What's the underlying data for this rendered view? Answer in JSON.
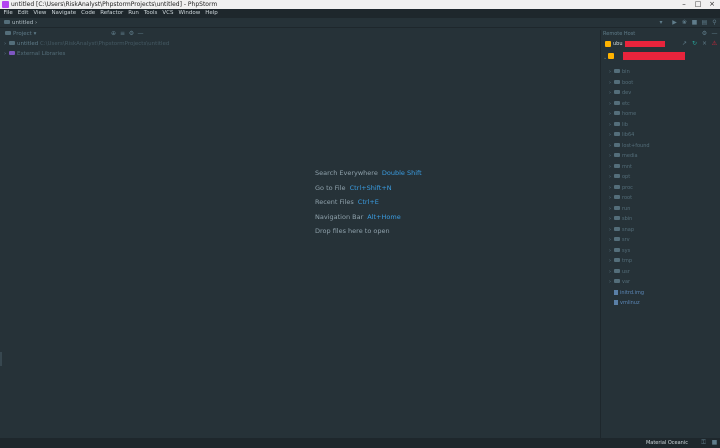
{
  "window": {
    "title": "untitled [C:\\Users\\RiskAnalyst\\PhpstormProjects\\untitled] - PhpStorm",
    "controls": [
      "minimize",
      "maximize",
      "close"
    ]
  },
  "menu": [
    "File",
    "Edit",
    "View",
    "Navigate",
    "Code",
    "Refactor",
    "Run",
    "Tools",
    "VCS",
    "Window",
    "Help"
  ],
  "navbar": {
    "breadcrumb": "untitled",
    "icons": [
      "run-config-dropdown-icon",
      "run-icon",
      "debug-icon",
      "stop-icon",
      "coverage-icon",
      "search-icon"
    ]
  },
  "project": {
    "view_label": "Project",
    "tree": [
      {
        "label": "untitled",
        "path": "C:\\Users\\RiskAnalyst\\PhpstormProjects\\untitled"
      },
      {
        "label": "External Libraries",
        "path": ""
      }
    ]
  },
  "welcome": [
    {
      "text": "Search Everywhere",
      "key": "Double Shift"
    },
    {
      "text": "Go to File",
      "key": "Ctrl+Shift+N"
    },
    {
      "text": "Recent Files",
      "key": "Ctrl+E"
    },
    {
      "text": "Navigation Bar",
      "key": "Alt+Home"
    },
    {
      "text": "Drop files here to open",
      "key": ""
    }
  ],
  "remote_host": {
    "title": "Remote Host",
    "server_prefix": "ubu",
    "folders": [
      "bin",
      "boot",
      "dev",
      "etc",
      "home",
      "lib",
      "lib64",
      "lost+found",
      "media",
      "mnt",
      "opt",
      "proc",
      "root",
      "run",
      "sbin",
      "snap",
      "srv",
      "sys",
      "tmp",
      "usr",
      "var"
    ],
    "files": [
      "initrd.img",
      "vmlinuz"
    ]
  },
  "status": {
    "theme": "Material Oceanic"
  },
  "colors": {
    "background": "#263238",
    "accent": "#3a9ce0",
    "redaction": "#e8243c"
  }
}
